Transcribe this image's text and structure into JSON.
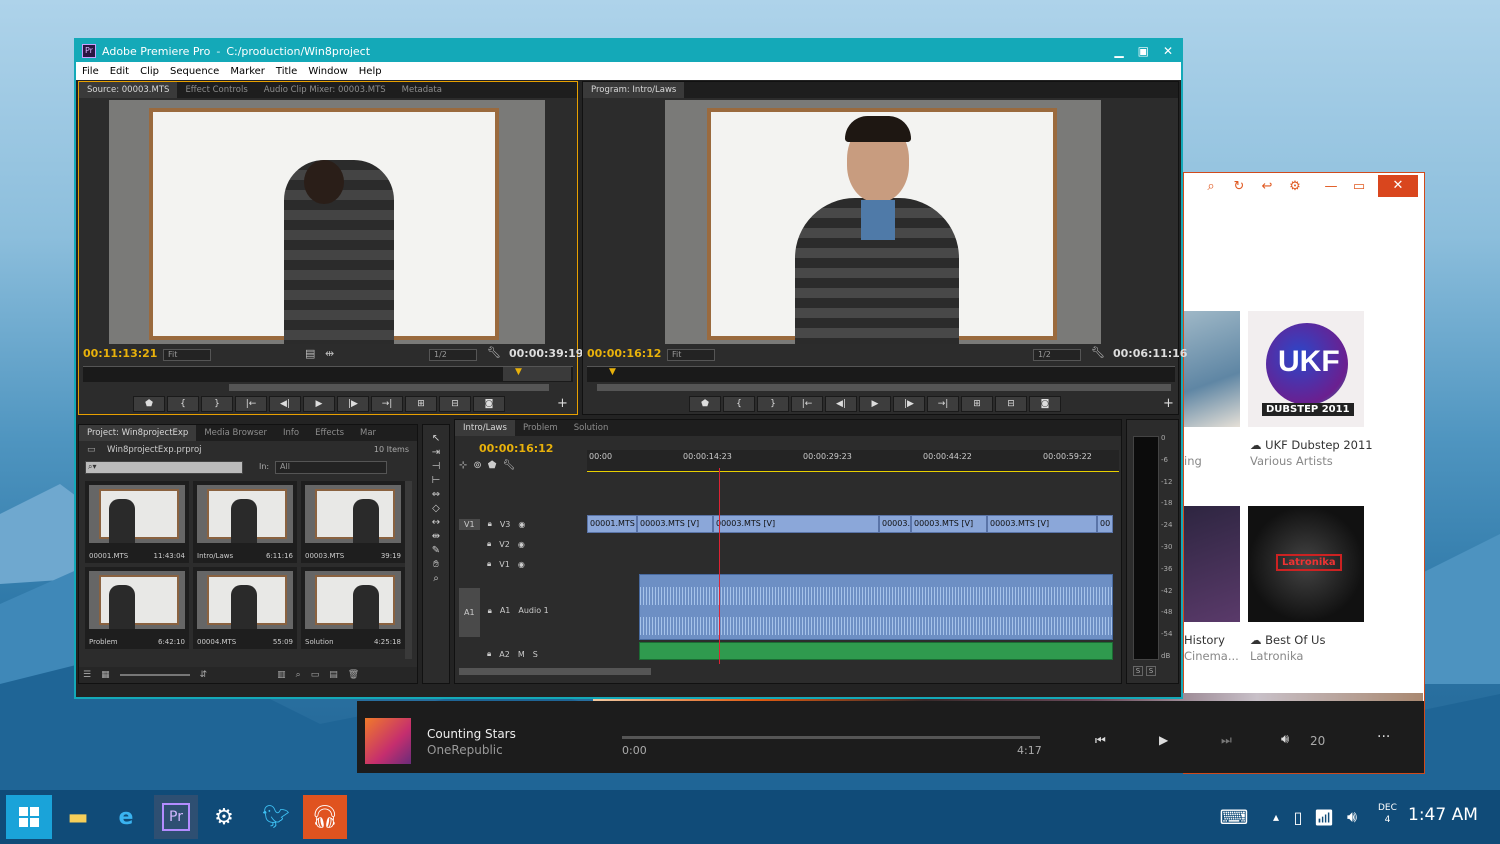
{
  "premiere": {
    "app_title": "Adobe Premiere Pro",
    "path": "C:/production/Win8project",
    "menu": [
      "File",
      "Edit",
      "Clip",
      "Sequence",
      "Marker",
      "Title",
      "Window",
      "Help"
    ],
    "source_tabs": [
      "Source: 00003.MTS",
      "Effect Controls",
      "Audio Clip Mixer: 00003.MTS",
      "Metadata"
    ],
    "program_tab": "Program: Intro/Laws",
    "source_tc_in": "00:11:13:21",
    "source_tc_dur": "00:00:39:19",
    "program_tc_in": "00:00:16:12",
    "program_tc_dur": "00:06:11:16",
    "fit": "Fit",
    "res": "1/2",
    "project_tabs": [
      "Project: Win8projectExp",
      "Media Browser",
      "Info",
      "Effects",
      "Mar"
    ],
    "project_file": "Win8projectExp.prproj",
    "items": "10 Items",
    "in_label": "In:",
    "in_value": "All",
    "bins": [
      {
        "name": "00001.MTS",
        "dur": "11:43:04"
      },
      {
        "name": "Intro/Laws",
        "dur": "6:11:16"
      },
      {
        "name": "00003.MTS",
        "dur": "39:19"
      },
      {
        "name": "Problem",
        "dur": "6:42:10"
      },
      {
        "name": "00004.MTS",
        "dur": "55:09"
      },
      {
        "name": "Solution",
        "dur": "4:25:18"
      }
    ],
    "timeline_tabs": [
      "Intro/Laws",
      "Problem",
      "Solution"
    ],
    "timeline_tc": "00:00:16:12",
    "ruler": [
      "00:00",
      "00:00:14:23",
      "00:00:29:23",
      "00:00:44:22",
      "00:00:59:22"
    ],
    "tracks": {
      "v3": "V3",
      "v2": "V2",
      "v1": "V1",
      "a1": "A1",
      "a1name": "Audio 1",
      "a2": "A2",
      "src": "V1",
      "srca": "A1"
    },
    "clips": [
      "00001.MTS",
      "00003.MTS [V]",
      "00003.MTS [V]",
      "00003.",
      "00003.MTS [V]",
      "00003.MTS [V]",
      "00"
    ],
    "meter": [
      "0",
      "-6",
      "-12",
      "-18",
      "-24",
      "-30",
      "-36",
      "-42",
      "-48",
      "-54",
      "dB"
    ]
  },
  "music": {
    "albums": [
      {
        "title": "UKF Dubstep 2011",
        "artist": "Various Artists"
      },
      {
        "title": "Best Of Us",
        "artist": "Latronika"
      }
    ],
    "partial": [
      "ing",
      "History",
      "Cinema..."
    ],
    "ukf_logo": "UKF",
    "ukf_sub": "DUBSTEP 2011",
    "lat_logo": "Latronika"
  },
  "nowplaying": {
    "song": "Counting Stars",
    "artist": "OneRepublic",
    "elapsed": "0:00",
    "total": "4:17",
    "volume": "20"
  },
  "taskbar": {
    "month": "DEC",
    "day": "4",
    "time": "1:47 AM"
  }
}
